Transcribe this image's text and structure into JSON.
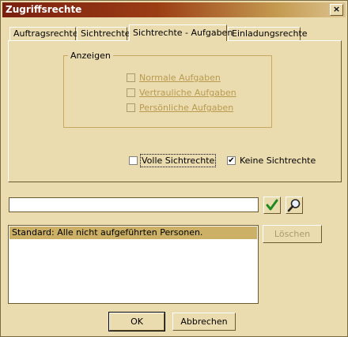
{
  "window": {
    "title": "Zugriffsrechte",
    "close_glyph": "×"
  },
  "tabs": [
    {
      "label": "Auftragsrechte"
    },
    {
      "label": "Sichtrechte"
    },
    {
      "label": "Sichtrechte - Aufgaben",
      "active": true
    },
    {
      "label": "Einladungsrechte"
    }
  ],
  "anzeigen": {
    "legend": "Anzeigen",
    "items": [
      {
        "label": "Normale Aufgaben",
        "checked": false,
        "enabled": false
      },
      {
        "label": "Vertrauliche Aufgaben",
        "checked": false,
        "enabled": false
      },
      {
        "label": "Persönliche Aufgaben",
        "checked": false,
        "enabled": false
      }
    ]
  },
  "options": {
    "volle": {
      "label": "Volle Sichtrechte",
      "checked": false
    },
    "keine": {
      "label": "Keine Sichtrechte",
      "checked": true,
      "check_glyph": "✔"
    }
  },
  "search": {
    "value": "",
    "confirm_icon": "check-icon",
    "search_icon": "magnifier-icon"
  },
  "list": {
    "items": [
      "Standard: Alle nicht aufgeführten Personen."
    ]
  },
  "buttons": {
    "delete": "Löschen",
    "ok": "OK",
    "cancel": "Abbrechen"
  },
  "colors": {
    "title_start": "#7a1f10",
    "title_end": "#dcc390",
    "background": "#ebdcb0",
    "selection": "#cbb066",
    "check_green": "#1f8a1f"
  }
}
